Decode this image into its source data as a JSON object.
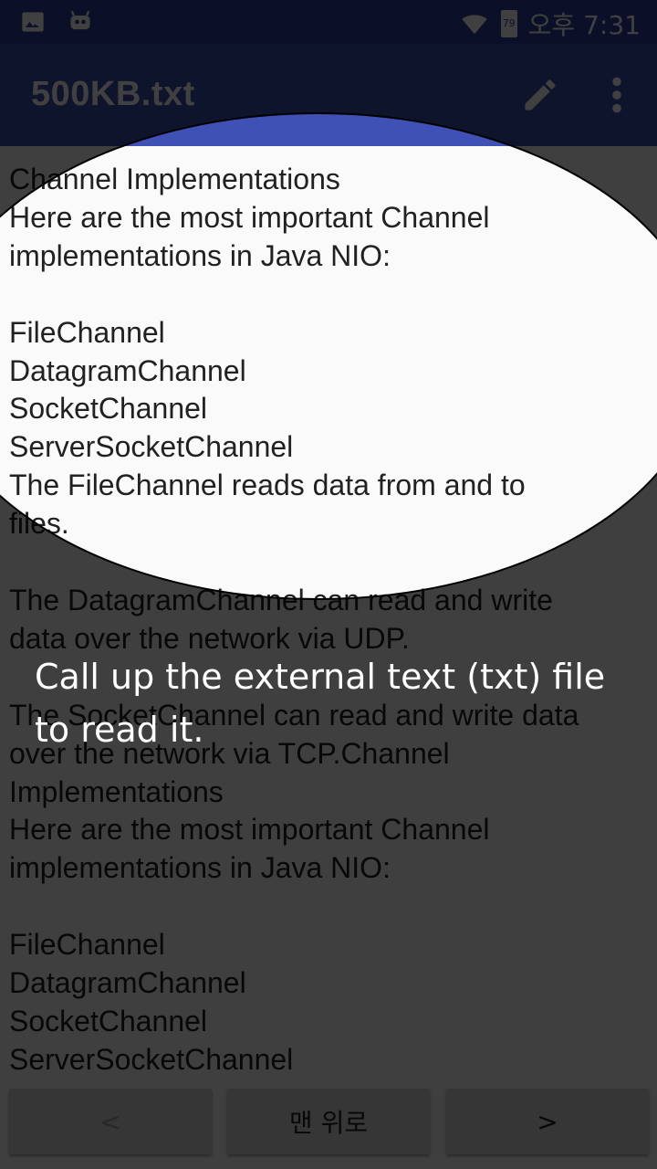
{
  "status_bar": {
    "battery": "79",
    "time": "오후 7:31",
    "icons": [
      "image-icon",
      "android-debug-icon",
      "wifi-icon",
      "battery-icon"
    ]
  },
  "app_bar": {
    "title": "500KB.txt",
    "actions": [
      "edit-icon",
      "more-vert-icon"
    ]
  },
  "document": {
    "lines": [
      "Channel Implementations",
      "Here are the most important Channel",
      "implementations in Java NIO:",
      "",
      "FileChannel",
      "DatagramChannel",
      "SocketChannel",
      "ServerSocketChannel",
      "The FileChannel reads data from and to",
      "files.",
      "",
      "The DatagramChannel can read and write",
      "data over the network via UDP.",
      "",
      "The SocketChannel can read and write data",
      "over the network via TCP.Channel",
      "Implementations",
      "Here are the most important Channel",
      "implementations in Java NIO:",
      "",
      "FileChannel",
      "DatagramChannel",
      "SocketChannel",
      "ServerSocketChannel"
    ]
  },
  "bottom_nav": {
    "prev_label": "<",
    "top_label": "맨 위로",
    "next_label": ">"
  },
  "coach_mark": {
    "text": "Call up the external text (txt) file to read it.",
    "overlay_color": "#000000",
    "overlay_opacity": 0.75
  },
  "colors": {
    "status_bar": "#303f9f",
    "app_bar": "#3f51b5",
    "page_background": "#fafafa"
  }
}
